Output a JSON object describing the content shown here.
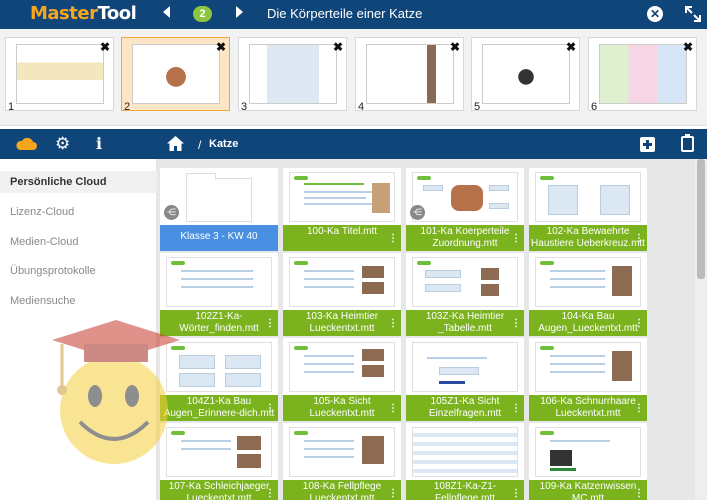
{
  "app": {
    "logo_part1": "Master",
    "logo_part2": "Tool",
    "page_number": "2",
    "doc_title": "Die Körperteile einer Katze"
  },
  "pages": [
    {
      "num": "1",
      "selected": false
    },
    {
      "num": "2",
      "selected": true
    },
    {
      "num": "3",
      "selected": false
    },
    {
      "num": "4",
      "selected": false
    },
    {
      "num": "5",
      "selected": false
    },
    {
      "num": "6",
      "selected": false
    }
  ],
  "breadcrumb": {
    "separator": "/",
    "current": "Katze"
  },
  "sidebar": {
    "items": [
      {
        "label": "Persönliche Cloud",
        "active": true
      },
      {
        "label": "Lizenz-Cloud",
        "active": false
      },
      {
        "label": "Medien-Cloud",
        "active": false
      },
      {
        "label": "Übungsprotokolle",
        "active": false
      },
      {
        "label": "Mediensuche",
        "active": false
      }
    ]
  },
  "files": [
    {
      "name": "Klasse 3 - KW 40",
      "type": "folder"
    },
    {
      "name": "100-Ka Titel.mtt",
      "type": "file"
    },
    {
      "name": "101-Ka Koerperteile Zuordnung.mtt",
      "type": "file"
    },
    {
      "name": "102-Ka Bewaehrte Haustiere Ueberkreuz.mtt",
      "type": "file"
    },
    {
      "name": "102Z1-Ka-Wörter_finden.mtt",
      "type": "file"
    },
    {
      "name": "103-Ka Heimtier Lueckentxt.mtt",
      "type": "file"
    },
    {
      "name": "103Z-Ka Heimtier _Tabelle.mtt",
      "type": "file"
    },
    {
      "name": "104-Ka Bau Augen_Lueckentxt.mtt",
      "type": "file"
    },
    {
      "name": "104Z1-Ka Bau Augen_Erinnere-dich.mtt",
      "type": "file"
    },
    {
      "name": "105-Ka Sicht Lueckentxt.mtt",
      "type": "file"
    },
    {
      "name": "105Z1-Ka Sicht Einzelfragen.mtt",
      "type": "file"
    },
    {
      "name": "106-Ka Schnurrhaare Lueckentxt.mtt",
      "type": "file"
    },
    {
      "name": "107-Ka Schleichjaeger Lueckentxt.mtt",
      "type": "file"
    },
    {
      "name": "108-Ka Fellpflege Lueckentxt.mtt",
      "type": "file"
    },
    {
      "name": "108Z1-Ka-Z1-Fellpflege.mtt",
      "type": "file"
    },
    {
      "name": "109-Ka Katzenwissen MC.mtt",
      "type": "file"
    }
  ],
  "colors": {
    "header": "#10457a",
    "accent_orange": "#f7a51d",
    "file_label": "#7bb31f",
    "folder_label": "#4a90e2"
  },
  "icons": {
    "cloud": "cloud-icon",
    "settings": "gear-icon",
    "info": "info-icon",
    "home": "home-icon",
    "add": "add-icon",
    "clipboard": "clipboard-icon",
    "share": "share-icon",
    "close": "close-icon",
    "fullscreen": "fullscreen-icon"
  }
}
